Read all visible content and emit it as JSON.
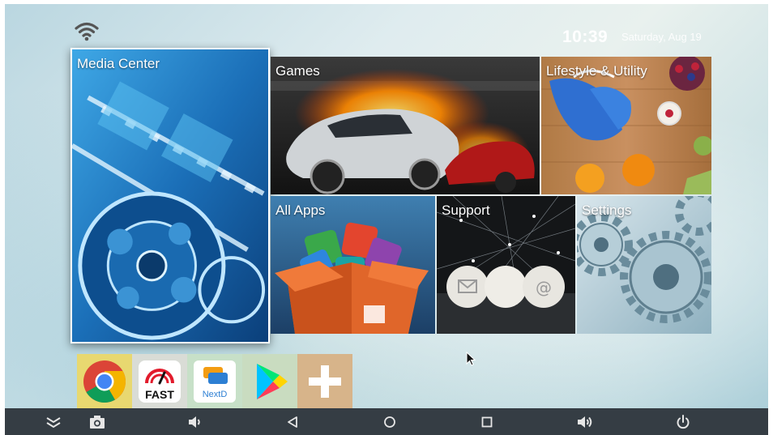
{
  "status_bar": {
    "time": "10:39",
    "date": "Saturday, Aug 19",
    "wifi_icon": "wifi-icon"
  },
  "tiles": {
    "media_center": "Media Center",
    "games": "Games",
    "lifestyle": "Lifestyle & Utility",
    "all_apps": "All Apps",
    "support": "Support",
    "settings": "Settings"
  },
  "dock": {
    "items": [
      {
        "name": "Chrome",
        "icon": "chrome-icon"
      },
      {
        "name": "FAST",
        "icon": "fast-speedtest-icon",
        "text": "FAST"
      },
      {
        "name": "NextD",
        "icon": "nextd-icon",
        "text": "NextD"
      },
      {
        "name": "Play Store",
        "icon": "play-store-icon"
      },
      {
        "name": "Add",
        "icon": "plus-icon"
      }
    ]
  },
  "navbar": {
    "buttons": [
      "collapse-icon",
      "screenshot-icon",
      "volume-down-icon",
      "back-icon",
      "home-icon",
      "recents-icon",
      "volume-up-icon",
      "power-icon"
    ]
  },
  "colors": {
    "navbar": "#353d44",
    "chrome_bg": "#e8d870",
    "fast_bg": "#d9dcd6",
    "nextd_bg": "#c7e0c8",
    "play_bg": "#c9dcc0",
    "plus_bg": "#d7b48a"
  }
}
